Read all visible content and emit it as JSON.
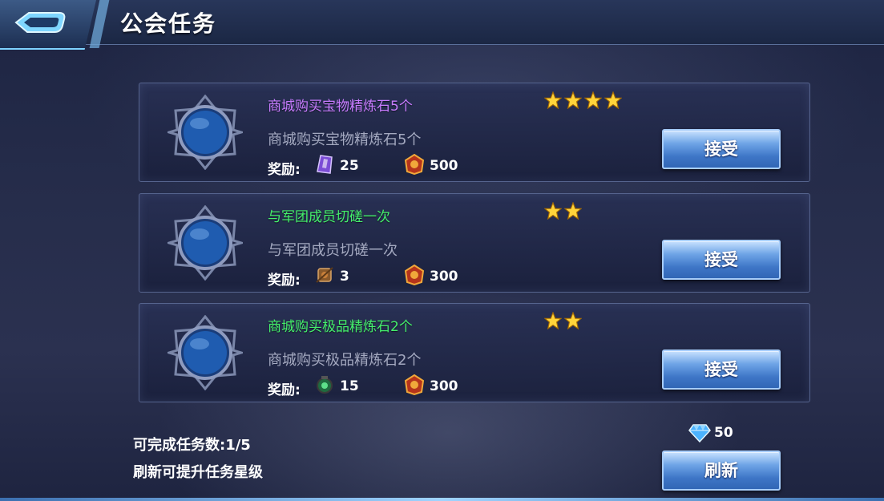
{
  "header": {
    "title": "公会任务"
  },
  "colors": {
    "purple_title": "#c77cff",
    "green_title": "#45f06c",
    "star": "#ffd43b"
  },
  "tasks": [
    {
      "title": "商城购买宝物精炼石5个",
      "title_color": "#c77cff",
      "description": "商城购买宝物精炼石5个",
      "stars": 4,
      "reward_label": "奖励:",
      "reward1_icon": "purple-crystal-icon",
      "reward1_value": "25",
      "reward2_icon": "guild-coin-icon",
      "reward2_value": "500",
      "button_label": "接受"
    },
    {
      "title": "与军团成员切磋一次",
      "title_color": "#45f06c",
      "description": "与军团成员切磋一次",
      "stars": 2,
      "reward_label": "奖励:",
      "reward1_icon": "bronze-scroll-icon",
      "reward1_value": "3",
      "reward2_icon": "guild-coin-icon",
      "reward2_value": "300",
      "button_label": "接受"
    },
    {
      "title": "商城购买极品精炼石2个",
      "title_color": "#45f06c",
      "description": "商城购买极品精炼石2个",
      "stars": 2,
      "reward_label": "奖励:",
      "reward1_icon": "green-gem-icon",
      "reward1_value": "15",
      "reward2_icon": "guild-coin-icon",
      "reward2_value": "300",
      "button_label": "接受"
    }
  ],
  "footer": {
    "completable": "可完成任务数:1/5",
    "hint": "刷新可提升任务星级",
    "cost_icon": "diamond-icon",
    "cost_value": "50",
    "refresh_label": "刷新"
  }
}
